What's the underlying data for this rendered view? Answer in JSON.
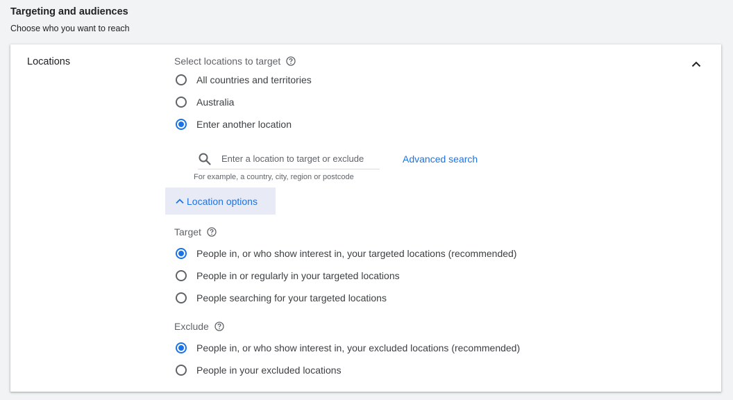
{
  "header": {
    "title": "Targeting and audiences",
    "subtitle": "Choose who you want to reach"
  },
  "locations": {
    "section_label": "Locations",
    "select_label": "Select locations to target",
    "options": [
      {
        "label": "All countries and territories",
        "checked": false
      },
      {
        "label": "Australia",
        "checked": false
      },
      {
        "label": "Enter another location",
        "checked": true
      }
    ],
    "search": {
      "placeholder": "Enter a location to target or exclude",
      "hint": "For example, a country, city, region or postcode"
    },
    "advanced_search_label": "Advanced search",
    "location_options_label": "Location options"
  },
  "target": {
    "label": "Target",
    "options": [
      {
        "label": "People in, or who show interest in, your targeted locations (recommended)",
        "checked": true
      },
      {
        "label": "People in or regularly in your targeted locations",
        "checked": false
      },
      {
        "label": "People searching for your targeted locations",
        "checked": false
      }
    ]
  },
  "exclude": {
    "label": "Exclude",
    "options": [
      {
        "label": "People in, or who show interest in, your excluded locations (recommended)",
        "checked": true
      },
      {
        "label": "People in your excluded locations",
        "checked": false
      }
    ]
  },
  "colors": {
    "accent": "#1a73e8",
    "accent_bg": "#e8eaf6",
    "text": "#202124",
    "muted": "#5f6368"
  },
  "icons": {
    "help": "help-circle-icon",
    "search": "search-icon",
    "collapse": "chevron-up-icon"
  }
}
